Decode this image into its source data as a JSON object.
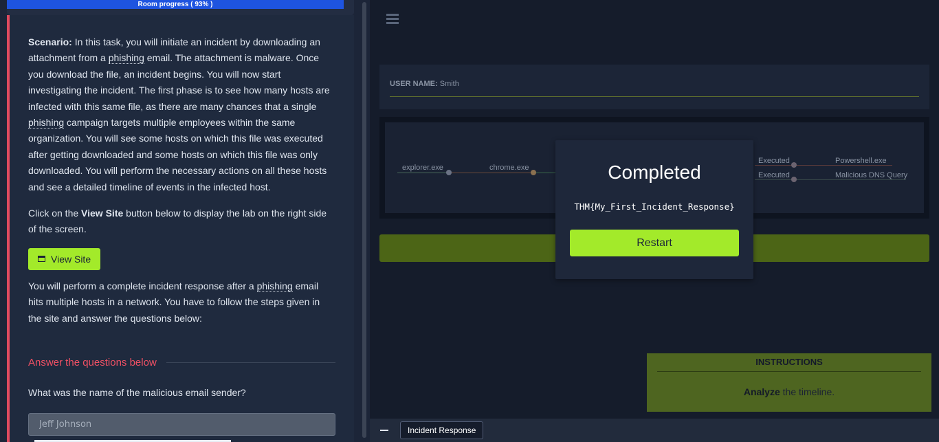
{
  "progress": {
    "label": "Room progress ( 93% )",
    "percent": 93
  },
  "task": {
    "scenario_label": "Scenario:",
    "scenario_text_1": " In this task, you will initiate an incident by downloading an attachment from a ",
    "phishing": "phishing",
    "scenario_text_2": " email. The attachment is malware. Once you download the file, an incident begins. You will now start investigating the incident. The first phase is to see how many hosts are infected with this same file, as there are many chances that a single ",
    "scenario_text_3": " campaign targets multiple employees within the same organization. You will see some hosts on which this file was executed after getting downloaded and some hosts on which this file was only downloaded. You will perform the necessary actions on all these hosts and see a detailed timeline of events in the infected host.",
    "click_text_1": "Click on the ",
    "view_site_bold": "View Site",
    "click_text_2": " button below to display the lab on the right side of the screen.",
    "view_site_button": "View Site",
    "perform_text_1": "You will perform a complete incident response after a ",
    "perform_text_2": " email hits multiple hosts in a network. You have to follow the steps given in the site and answer the questions below:"
  },
  "answers": {
    "heading": "Answer the questions below",
    "question": "What was the name of the malicious email sender?",
    "placeholder": "Jeff Johnson"
  },
  "lab": {
    "username_label": "USER NAME:",
    "username_value": "Smith",
    "timeline": {
      "explorer": "explorer.exe",
      "chrome": "chrome.exe",
      "executed_1": "Executed",
      "executed_2": "Executed",
      "powershell": "Powershell.exe",
      "dns": "Malicious DNS Query"
    },
    "instructions": {
      "title": "INSTRUCTIONS",
      "bold": "Analyze",
      "text": " the timeline."
    },
    "tab_label": "Incident Response"
  },
  "modal": {
    "title": "Completed",
    "flag": "THM{My_First_Incident_Response}",
    "restart": "Restart"
  },
  "colors": {
    "accent_green": "#a3ea2a",
    "progress_blue": "#1e54e0",
    "alert_red": "#ef5064"
  }
}
